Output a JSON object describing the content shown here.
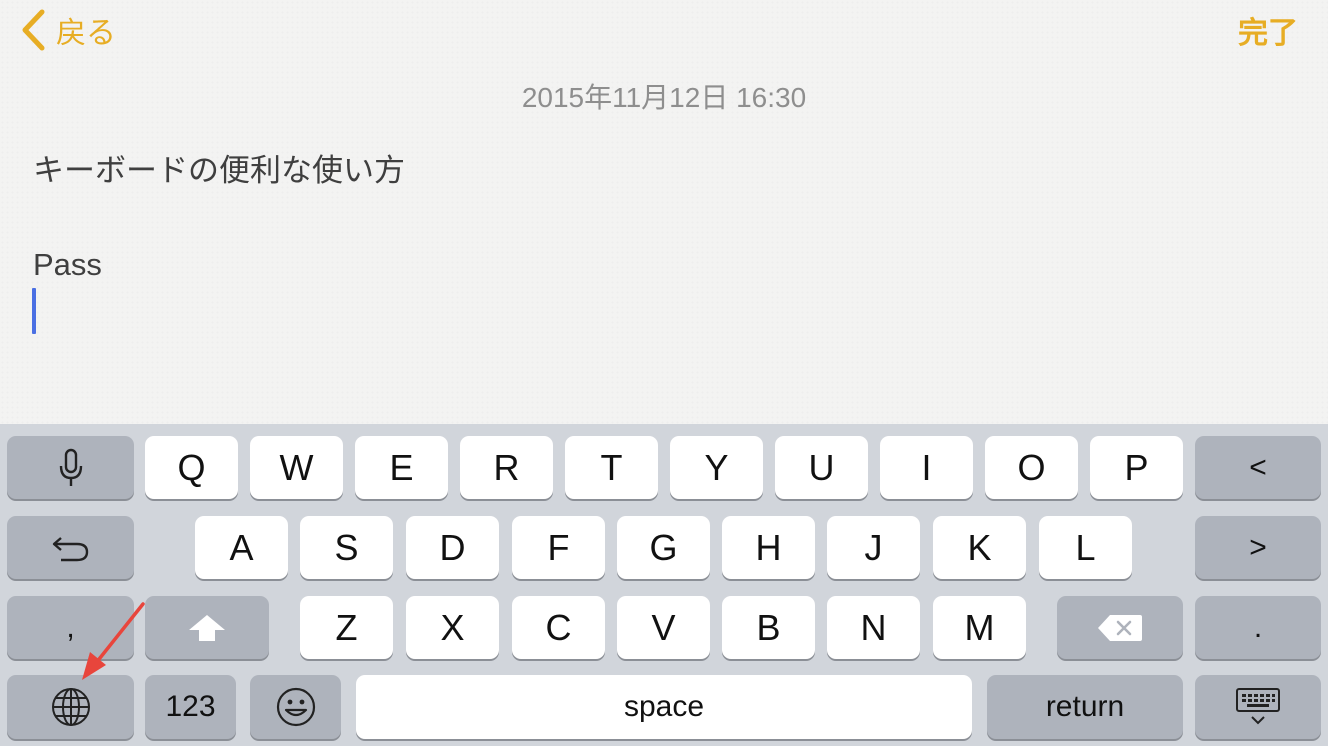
{
  "header": {
    "back_label": "戻る",
    "done_label": "完了"
  },
  "note": {
    "date": "2015年11月12日 16:30",
    "title": "キーボードの便利な使い方",
    "body_line": "Pass"
  },
  "keyboard": {
    "row1": [
      "Q",
      "W",
      "E",
      "R",
      "T",
      "Y",
      "U",
      "I",
      "O",
      "P"
    ],
    "row2": [
      "A",
      "S",
      "D",
      "F",
      "G",
      "H",
      "J",
      "K",
      "L"
    ],
    "row3": [
      "Z",
      "X",
      "C",
      "V",
      "B",
      "N",
      "M"
    ],
    "comma_label": ",",
    "period_label": ".",
    "numbers_label": "123",
    "space_label": "space",
    "return_label": "return",
    "left_label": "<",
    "right_label": ">"
  },
  "colors": {
    "accent": "#e7ad24",
    "caret": "#4a6fe3",
    "annotation_arrow": "#e8453c"
  }
}
